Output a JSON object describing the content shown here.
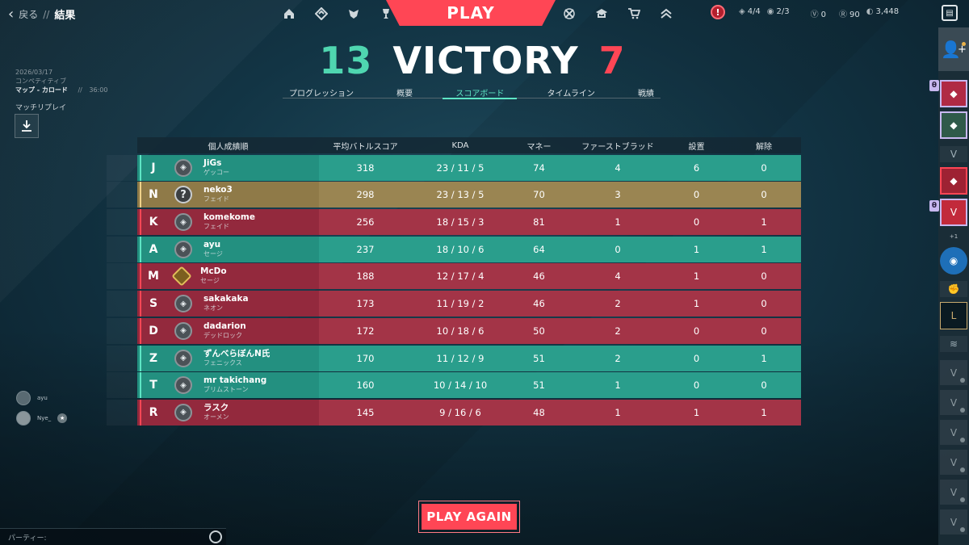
{
  "topbar": {
    "back_label": "戻る",
    "separator": "//",
    "current_page": "結果",
    "play_label": "PLAY",
    "nav_left_icons": [
      "home-icon",
      "agents-icon",
      "career-icon",
      "collection-icon"
    ],
    "nav_right_icons": [
      "battlepass-icon",
      "career-pass-icon",
      "store-icon",
      "rank-icon"
    ],
    "alert_label": "!",
    "missions": "4/4",
    "weeklies": "2/3",
    "vp": "0",
    "radianite": "90",
    "kingdom_credits": "3,448",
    "accent_color": "#ff4655"
  },
  "match_info": {
    "date": "2026/03/17",
    "mode": "コンペティティブ",
    "map": "マップ - カロード",
    "separator": "//",
    "duration": "36:00",
    "replay_label": "マッチリプレイ",
    "replay_icon": "download-icon"
  },
  "result": {
    "score_team": "13",
    "result_label": "VICTORY",
    "score_enemy": "7",
    "win_color": "#4fd6b0",
    "loss_color": "#ff4655"
  },
  "tabs": [
    {
      "label": "プログレッション"
    },
    {
      "label": "概要"
    },
    {
      "label": "スコアボード"
    },
    {
      "label": "タイムライン"
    },
    {
      "label": "戦績"
    }
  ],
  "scoreboard": {
    "headers": {
      "name": "個人成績順",
      "acs": "平均バトルスコア",
      "kda": "KDA",
      "money": "マネー",
      "first_blood": "ファーストブラッド",
      "plants": "設置",
      "defuses": "解除"
    },
    "rows": [
      {
        "name": "JiGs",
        "agent": "ゲッコー",
        "acs": "318",
        "kda": "23 / 11 / 5",
        "money": "74",
        "fb": "4",
        "plants": "6",
        "defuses": "0",
        "team": "green",
        "rank": "unranked-rank-icon",
        "initial": "J"
      },
      {
        "name": "neko3",
        "agent": "フェイド",
        "acs": "298",
        "kda": "23 / 13 / 5",
        "money": "70",
        "fb": "3",
        "plants": "0",
        "defuses": "0",
        "team": "gold",
        "rank": "unknown-rank-icon",
        "initial": "N"
      },
      {
        "name": "komekome",
        "agent": "フェイド",
        "acs": "256",
        "kda": "18 / 15 / 3",
        "money": "81",
        "fb": "1",
        "plants": "0",
        "defuses": "1",
        "team": "red",
        "rank": "unranked-rank-icon",
        "initial": "K"
      },
      {
        "name": "ayu",
        "agent": "セージ",
        "acs": "237",
        "kda": "18 / 10 / 6",
        "money": "64",
        "fb": "0",
        "plants": "1",
        "defuses": "1",
        "team": "green",
        "rank": "unranked-rank-icon",
        "initial": "A"
      },
      {
        "name": "McDo",
        "agent": "セージ",
        "acs": "188",
        "kda": "12 / 17 / 4",
        "money": "46",
        "fb": "4",
        "plants": "1",
        "defuses": "0",
        "team": "red",
        "rank": "gold-rank-icon",
        "initial": "M"
      },
      {
        "name": "sakakaka",
        "agent": "ネオン",
        "acs": "173",
        "kda": "11 / 19 / 2",
        "money": "46",
        "fb": "2",
        "plants": "1",
        "defuses": "0",
        "team": "red",
        "rank": "unranked-rank-icon",
        "initial": "S"
      },
      {
        "name": "dadarion",
        "agent": "デッドロック",
        "acs": "172",
        "kda": "10 / 18 / 6",
        "money": "50",
        "fb": "2",
        "plants": "0",
        "defuses": "0",
        "team": "red",
        "rank": "unranked-rank-icon",
        "initial": "D"
      },
      {
        "name": "ずんべらぼんN氏",
        "agent": "フェニックス",
        "acs": "170",
        "kda": "11 / 12 / 9",
        "money": "51",
        "fb": "2",
        "plants": "0",
        "defuses": "1",
        "team": "green",
        "rank": "unranked-rank-icon",
        "initial": "Z"
      },
      {
        "name": "mr takichang",
        "agent": "ブリムストーン",
        "acs": "160",
        "kda": "10 / 14 / 10",
        "money": "51",
        "fb": "1",
        "plants": "0",
        "defuses": "0",
        "team": "green",
        "rank": "unranked-rank-icon",
        "initial": "T"
      },
      {
        "name": "ラスク",
        "agent": "オーメン",
        "acs": "145",
        "kda": "9 / 16 / 6",
        "money": "48",
        "fb": "1",
        "plants": "1",
        "defuses": "1",
        "team": "red",
        "rank": "unranked-rank-icon",
        "initial": "R"
      }
    ],
    "colors": {
      "ally": "#2a9e8c",
      "enemy": "#a33447",
      "self": "#9a8552"
    }
  },
  "play_again_label": "PLAY AGAIN",
  "party": {
    "members": [
      {
        "name": "ayu"
      },
      {
        "name": "Nye_"
      }
    ],
    "bar_label": "パーティー:"
  },
  "sidebar": {
    "more_label": "+1"
  }
}
